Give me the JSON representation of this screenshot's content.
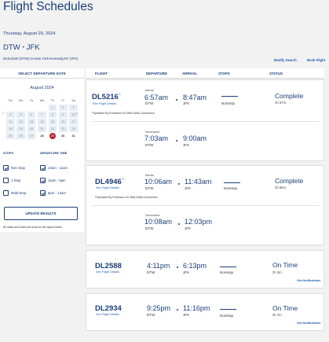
{
  "page": {
    "title": "Flight Schedules",
    "date_line": "Thursday, August 29, 2024",
    "origin": "DTW",
    "destination": "JFK",
    "route_sub": "Detroit,MI (DTW) to New York-Kennedy,NY (JFK)",
    "modify_search": "Modify Search",
    "book_flight": "Book Flight"
  },
  "sidebar": {
    "heading": "SELECT DEPARTURE DATE",
    "month": "August 2024",
    "weekdays": [
      "Su",
      "Mo",
      "Tu",
      "We",
      "Th",
      "Fr",
      "Sa"
    ],
    "weeks": [
      [
        "",
        "",
        "",
        "",
        "1",
        "2",
        "3"
      ],
      [
        "4",
        "5",
        "6",
        "7",
        "8",
        "9",
        "10"
      ],
      [
        "11",
        "12",
        "13",
        "14",
        "15",
        "16",
        "17"
      ],
      [
        "18",
        "19",
        "20",
        "21",
        "22",
        "23",
        "24"
      ],
      [
        "25",
        "26",
        "27",
        "28",
        "29",
        "30",
        "31"
      ]
    ],
    "selected_day": "29",
    "stops_heading": "STOPS",
    "time_heading": "DEPARTURE TIME",
    "stop_options": [
      {
        "label": "Non Stop",
        "checked": true
      },
      {
        "label": "1 Stop",
        "checked": false
      },
      {
        "label": "Multi-Stop",
        "checked": false
      }
    ],
    "time_options": [
      {
        "label": "12am - 11am",
        "checked": true
      },
      {
        "label": "11am - 6pm",
        "checked": true
      },
      {
        "label": "6pm - 12am",
        "checked": true
      }
    ],
    "update_button": "UPDATE RESULTS",
    "note": "All dates and times are local for the airport listed."
  },
  "table_header": {
    "flight": "FLIGHT",
    "departure": "DEPARTURE",
    "arrival": "ARRIVAL",
    "stops": "STOPS",
    "status": "STATUS"
  },
  "flights": [
    {
      "number": "DL5216",
      "footnote": "1",
      "details_link": "See Flight Details",
      "actual_label": "Actual",
      "actual_dep": "6:57am",
      "actual_arr": "8:47am",
      "scheduled_label": "Scheduled",
      "scheduled_dep": "7:03am",
      "scheduled_arr": "9:00am",
      "dep_airport": "DTW",
      "arr_airport": "JFK",
      "stops": "Nonstop",
      "status": "Complete",
      "duration": "1h 57m",
      "operated_note": "¹Operated By Endeavor Air DBA Delta Connection"
    },
    {
      "number": "DL4946",
      "footnote": "2",
      "details_link": "See Flight Details",
      "actual_label": "Actual",
      "actual_dep": "10:06am",
      "actual_arr": "11:43am",
      "scheduled_label": "Scheduled",
      "scheduled_dep": "10:08am",
      "scheduled_arr": "12:03pm",
      "dep_airport": "DTW",
      "arr_airport": "JFK",
      "stops": "Nonstop",
      "status": "Complete",
      "duration": "1h 55m",
      "operated_note": "²Operated By Endeavor Air DBA Delta Connection"
    },
    {
      "number": "DL2588",
      "details_link": "See Flight Details",
      "dep": "4:11pm",
      "arr": "6:13pm",
      "dep_airport": "DTW",
      "arr_airport": "JFK",
      "stops": "Nonstop",
      "status": "On Time",
      "duration": "2h 3m",
      "notifications": "Get Notifications"
    },
    {
      "number": "DL2934",
      "details_link": "See Flight Details",
      "dep": "9:25pm",
      "arr": "11:16pm",
      "dep_airport": "DTW",
      "arr_airport": "JFK",
      "stops": "Nonstop",
      "status": "On Time",
      "duration": "2h 7m",
      "notifications": "Get Notifications"
    }
  ]
}
